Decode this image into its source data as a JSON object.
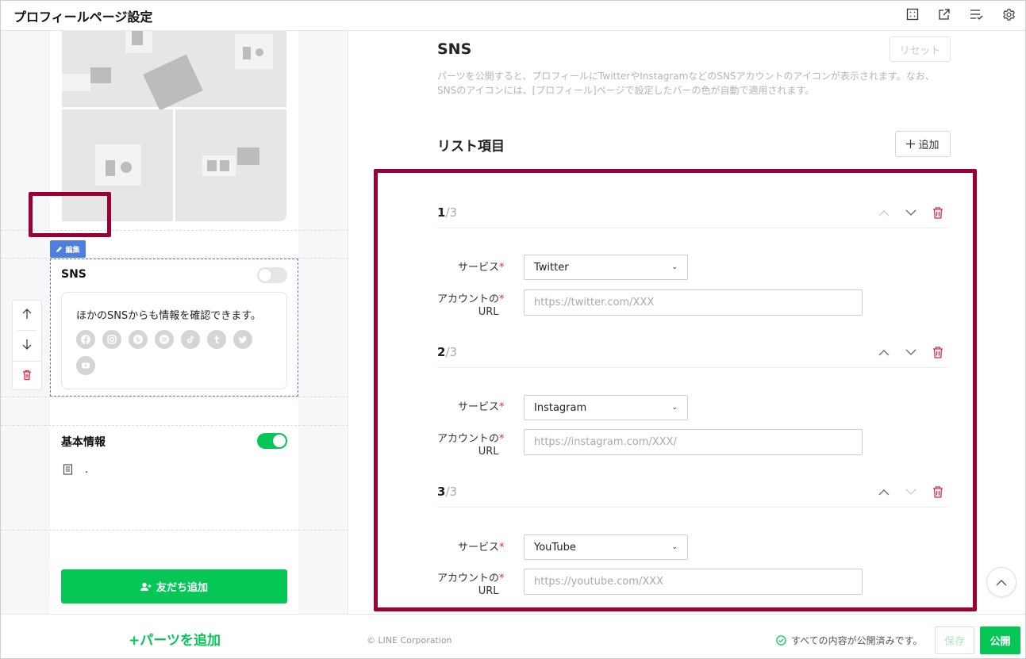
{
  "header": {
    "title": "プロフィールページ設定",
    "icons": [
      "grid-icon",
      "open-external-icon",
      "list-check-icon",
      "gear-icon"
    ]
  },
  "preview": {
    "edit_badge": "編集",
    "sns": {
      "label": "SNS",
      "enabled": false,
      "card_text": "ほかのSNSからも情報を確認できます。",
      "icons": [
        "facebook-icon",
        "instagram-icon",
        "pinterest-icon",
        "spotify-icon",
        "tiktok-icon",
        "tumblr-icon",
        "twitter-icon",
        "youtube-icon"
      ]
    },
    "basic_info": {
      "label": "基本情報",
      "enabled": true,
      "row_text": "."
    },
    "add_friend_button": "友だち追加",
    "add_parts_button": "+パーツを追加"
  },
  "editor": {
    "section_title": "SNS",
    "reset_button": "リセット",
    "description": "パーツを公開すると、プロフィールにTwitterやInstagramなどのSNSアカウントのアイコンが表示されます。なお、SNSのアイコンには、[プロフィール]ページで設定したバーの色が自動で適用されます。",
    "list_title": "リスト項目",
    "add_button": "追加",
    "service_label": "サービス",
    "url_label_line1": "アカウントの",
    "url_label_line2": "URL",
    "required_mark": "*",
    "items": [
      {
        "index": "1",
        "total": "/3",
        "service": "Twitter",
        "url_placeholder": "https://twitter.com/XXX"
      },
      {
        "index": "2",
        "total": "/3",
        "service": "Instagram",
        "url_placeholder": "https://instagram.com/XXX/"
      },
      {
        "index": "3",
        "total": "/3",
        "service": "YouTube",
        "url_placeholder": "https://youtube.com/XXX"
      }
    ]
  },
  "footer": {
    "copyright": "© LINE Corporation",
    "status_text": "すべての内容が公開済みです。",
    "save_button": "保存",
    "publish_button": "公開"
  },
  "colors": {
    "accent_green": "#06c755",
    "highlight_red": "#9b0034",
    "edit_blue": "#4d7fe0",
    "delete_red": "#e0274a"
  }
}
